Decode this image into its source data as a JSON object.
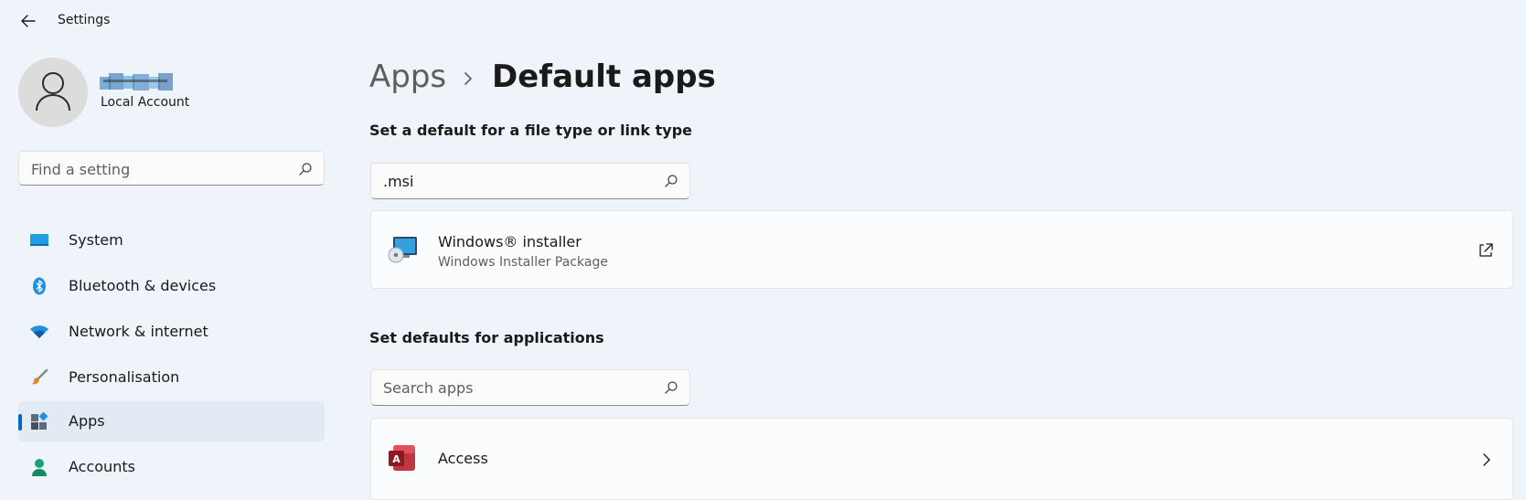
{
  "window": {
    "title": "Settings"
  },
  "user": {
    "account_type": "Local Account"
  },
  "sidebar": {
    "search": {
      "placeholder": "Find a setting"
    },
    "items": [
      {
        "label": "System",
        "icon": "monitor-icon",
        "active": false
      },
      {
        "label": "Bluetooth & devices",
        "icon": "bluetooth-icon",
        "active": false
      },
      {
        "label": "Network & internet",
        "icon": "wifi-icon",
        "active": false
      },
      {
        "label": "Personalisation",
        "icon": "brush-icon",
        "active": false
      },
      {
        "label": "Apps",
        "icon": "apps-icon",
        "active": true
      },
      {
        "label": "Accounts",
        "icon": "person-icon",
        "active": false
      }
    ]
  },
  "main": {
    "breadcrumb": {
      "parent": "Apps",
      "current": "Default apps"
    },
    "file_type": {
      "heading": "Set a default for a file type or link type",
      "search_value": ".msi",
      "result": {
        "title": "Windows® installer",
        "subtitle": "Windows Installer Package",
        "icon": "installer-icon",
        "action_icon": "open-external-icon"
      }
    },
    "applications": {
      "heading": "Set defaults for applications",
      "search_placeholder": "Search apps",
      "items": [
        {
          "title": "Access",
          "icon": "access-icon"
        }
      ]
    }
  },
  "colors": {
    "accent": "#0067c0",
    "background": "#eef4f9",
    "card": "#fbfcfd"
  }
}
